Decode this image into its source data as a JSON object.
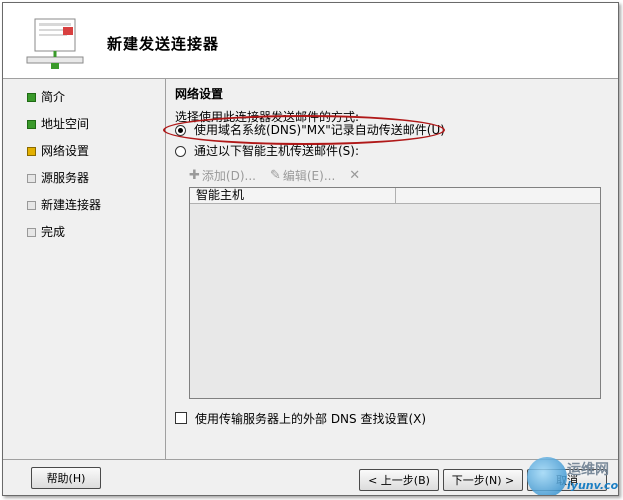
{
  "header": {
    "title": "新建发送连接器",
    "icon": "connector-wizard-icon"
  },
  "nav": {
    "items": [
      {
        "label": "简介",
        "state": "done"
      },
      {
        "label": "地址空间",
        "state": "done"
      },
      {
        "label": "网络设置",
        "state": "current"
      },
      {
        "label": "源服务器",
        "state": "pending"
      },
      {
        "label": "新建连接器",
        "state": "pending"
      },
      {
        "label": "完成",
        "state": "pending"
      }
    ]
  },
  "content": {
    "section_title": "网络设置",
    "prompt": "选择使用此连接器发送邮件的方式:",
    "option_dns": "使用域名系统(DNS)\"MX\"记录自动传送邮件(U)",
    "option_smarthost": "通过以下智能主机传送邮件(S):",
    "selected_option": "dns",
    "toolbar": {
      "add_label": "添加(D)...",
      "edit_label": "编辑(E)..."
    },
    "list": {
      "column_header": "智能主机",
      "rows": []
    },
    "external_dns_label": "使用传输服务器上的外部 DNS 查找设置(X)",
    "external_dns_checked": false
  },
  "buttons": {
    "help": "帮助(H)",
    "back": "< 上一步(B)",
    "next": "下一步(N) >",
    "cancel": "取消"
  },
  "watermark": {
    "line1": "运维网",
    "line2": "iyunv.com"
  },
  "colors": {
    "done": "#3a9a2a",
    "current": "#e3b000",
    "highlight": "#b01818"
  }
}
